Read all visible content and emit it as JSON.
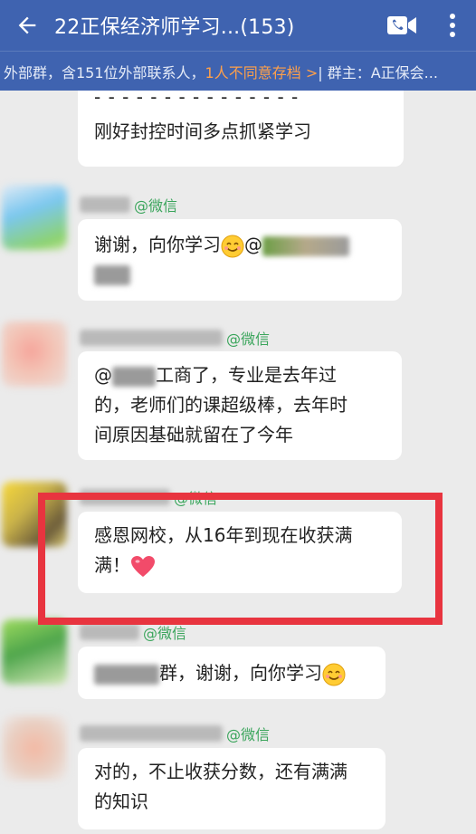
{
  "header": {
    "title": "22正保经济师学习...(153)"
  },
  "infobar": {
    "part1": "外部群，含151位外部联系人，",
    "part2": "1人不同意存档 >",
    "part3": " | 群主：A正保会..."
  },
  "messages": {
    "m0": {
      "line1": "- - - - - - - - - - - - - - -",
      "line2": "刚好封控时间多点抓紧学习"
    },
    "m1": {
      "sender_suffix": "@微信",
      "text1": "谢谢，向你学习",
      "at": "@"
    },
    "m2": {
      "sender_suffix": "@微信",
      "line1_prefix": "@",
      "line1_suffix": "工商了，专业是去年过",
      "line2": "的，老师们的课超级棒，去年时",
      "line3": "间原因基础就留在了今年"
    },
    "m3": {
      "sender_suffix": "@微信",
      "line1": "感恩网校，从16年到现在收获满",
      "line2": "满！"
    },
    "m4": {
      "sender_suffix": "@微信",
      "text_suffix": "群，谢谢，向你学习"
    },
    "m5": {
      "sender_suffix": "@微信",
      "line1": "对的，不止收获分数，还有满满",
      "line2": "的知识"
    }
  },
  "colors": {
    "header_bg": "#3f63b0",
    "highlight": "#e8343f",
    "wechat_green": "#3ba55c",
    "notice_orange": "#ffa04a"
  },
  "icons": [
    "back-arrow-icon",
    "video-call-icon",
    "more-vert-icon",
    "smile-emoji-icon",
    "heart-emoji-icon"
  ]
}
